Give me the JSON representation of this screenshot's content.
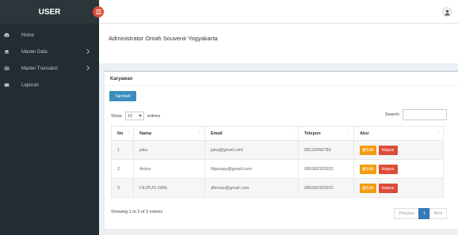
{
  "sidebar": {
    "brand": "USER",
    "items": [
      {
        "label": "Home",
        "icon": "dashboard-icon"
      },
      {
        "label": "Master Data",
        "icon": "laptop-icon",
        "has_submenu": true
      },
      {
        "label": "Master Transaksi",
        "icon": "table-icon",
        "has_submenu": true
      },
      {
        "label": "Laporan",
        "icon": "book-icon"
      }
    ]
  },
  "header": {
    "title": "Administrator Omah Souvenir Yogyakarta"
  },
  "box": {
    "title": "Karyawan",
    "add_button": "Tambah"
  },
  "table_controls": {
    "show_label": "Show",
    "entries_value": "10",
    "entries_label": "entries",
    "search_label": "Search:"
  },
  "table": {
    "headers": [
      "No",
      "Nama",
      "Email",
      "Telepon",
      "Aksi"
    ],
    "rows": [
      {
        "no": "1",
        "nama": "jaka",
        "email": "jaka@gmail.com",
        "telepon": "08123456789"
      },
      {
        "no": "2",
        "nama": "Anton",
        "email": "filipusipy@gmail.com",
        "telepon": "085383320022"
      },
      {
        "no": "3",
        "nama": "FILIPUS IVAN",
        "email": "dhimas@gmail.com",
        "telepon": "085383320022"
      }
    ],
    "edit_label": "Edit",
    "delete_label": "Hapus"
  },
  "footer": {
    "info": "Showing 1 to 3 of 3 entries",
    "previous": "Previous",
    "page": "1",
    "next": "Next"
  },
  "colors": {
    "sidebar_bg": "#222d32",
    "primary": "#3c8dbc",
    "warning": "#f39c12",
    "danger": "#dd4b39"
  }
}
